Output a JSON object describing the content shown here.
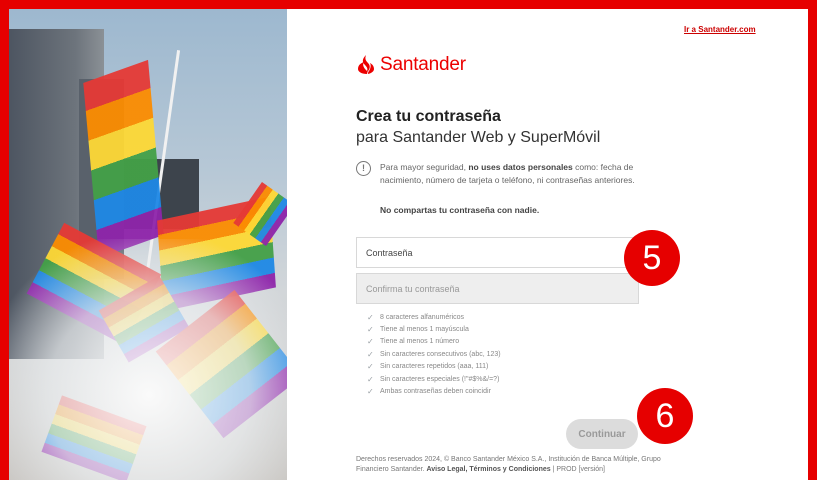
{
  "header": {
    "link_label": "Ir a Santander.com"
  },
  "brand": {
    "name": "Santander",
    "color": "#ec0000"
  },
  "form": {
    "title": "Crea tu contraseña",
    "subtitle": "para Santander Web y SuperMóvil",
    "info_icon": "info-circle-icon",
    "info_prefix": "Para mayor seguridad, ",
    "info_emphasis": "no uses datos personales",
    "info_suffix": " como: fecha de nacimiento, número de tarjeta o teléfono, ni contraseñas anteriores.",
    "info_bold": "No compartas tu contraseña con nadie.",
    "password_placeholder": "Contraseña",
    "confirm_placeholder": "Confirma tu contraseña",
    "rules": [
      "8 caracteres alfanuméricos",
      "Tiene al menos 1 mayúscula",
      "Tiene al menos 1 número",
      "Sin caracteres consecutivos (abc, 123)",
      "Sin caracteres repetidos (aaa, 111)",
      "Sin caracteres especiales (!\"#$%&/=?)",
      "Ambas contraseñas deben coincidir"
    ],
    "continue_label": "Continuar"
  },
  "footer": {
    "text": "Derechos reservados 2024, © Banco Santander México S.A., Institución de Banca Múltiple, Grupo Financiero Santander. ",
    "links": "Aviso Legal, Términos y Condiciones",
    "suffix": " | PROD [versión]"
  },
  "annotations": {
    "marker_a": "5",
    "marker_b": "6"
  }
}
